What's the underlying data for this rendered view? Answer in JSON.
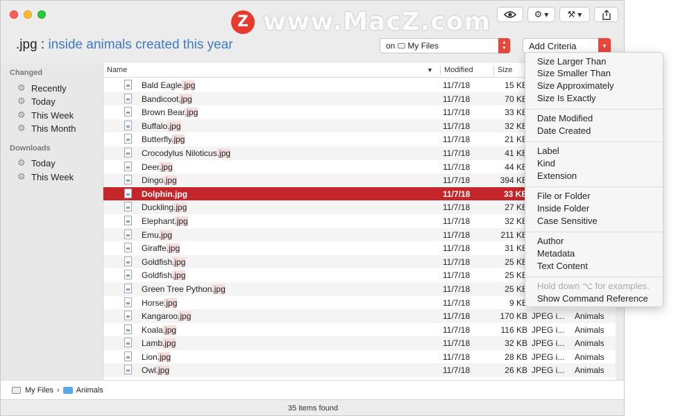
{
  "watermark": {
    "logo_letter": "Z",
    "text": "www.MacZ.com"
  },
  "toolbar": {
    "eye_icon": "eye-icon",
    "gear_icon": "gear-icon",
    "tools_icon": "tools-icon",
    "share_icon": "share-icon"
  },
  "query": {
    "extension": ".jpg",
    "colon": ":",
    "description": "inside animals created this year"
  },
  "location": {
    "prefix": "on",
    "value": "My Files"
  },
  "criteria_button": {
    "label": "Add Criteria"
  },
  "sidebar": {
    "sections": [
      {
        "heading": "Changed",
        "items": [
          "Recently",
          "Today",
          "This Week",
          "This Month"
        ]
      },
      {
        "heading": "Downloads",
        "items": [
          "Today",
          "This Week"
        ]
      }
    ]
  },
  "table": {
    "columns": {
      "name": "Name",
      "modified": "Modified",
      "size": "Size"
    },
    "rows": [
      {
        "base": "Bald Eagle",
        "ext": ".jpg",
        "modified": "11/7/18",
        "size": "15 KB",
        "kind": "",
        "folder": ""
      },
      {
        "base": "Bandicoot",
        "ext": ".jpg",
        "modified": "11/7/18",
        "size": "70 KB",
        "kind": "",
        "folder": ""
      },
      {
        "base": "Brown Bear",
        "ext": ".jpg",
        "modified": "11/7/18",
        "size": "33 KB",
        "kind": "",
        "folder": ""
      },
      {
        "base": "Buffalo",
        "ext": ".jpg",
        "modified": "11/7/18",
        "size": "32 KB",
        "kind": "",
        "folder": ""
      },
      {
        "base": "Butterfly",
        "ext": ".jpg",
        "modified": "11/7/18",
        "size": "21 KB",
        "kind": "",
        "folder": ""
      },
      {
        "base": "Crocodylus Niloticus",
        "ext": ".jpg",
        "modified": "11/7/18",
        "size": "41 KB",
        "kind": "",
        "folder": ""
      },
      {
        "base": "Deer",
        "ext": ".jpg",
        "modified": "11/7/18",
        "size": "44 KB",
        "kind": "",
        "folder": ""
      },
      {
        "base": "Dingo",
        "ext": ".jpg",
        "modified": "11/7/18",
        "size": "394 KB",
        "kind": "",
        "folder": ""
      },
      {
        "base": "Dolphin",
        "ext": ".jpg",
        "modified": "11/7/18",
        "size": "33 KB",
        "kind": "",
        "folder": "",
        "selected": true
      },
      {
        "base": "Duckling",
        "ext": ".jpg",
        "modified": "11/7/18",
        "size": "27 KB",
        "kind": "",
        "folder": ""
      },
      {
        "base": "Elephant",
        "ext": ".jpg",
        "modified": "11/7/18",
        "size": "32 KB",
        "kind": "",
        "folder": ""
      },
      {
        "base": "Emu",
        "ext": ".jpg",
        "modified": "11/7/18",
        "size": "211 KB",
        "kind": "",
        "folder": ""
      },
      {
        "base": "Giraffe",
        "ext": ".jpg",
        "modified": "11/7/18",
        "size": "31 KB",
        "kind": "",
        "folder": ""
      },
      {
        "base": "Goldfish",
        "ext": ".jpg",
        "modified": "11/7/18",
        "size": "25 KB",
        "kind": "",
        "folder": ""
      },
      {
        "base": "Goldfish",
        "ext": ".jpg",
        "modified": "11/7/18",
        "size": "25 KB",
        "kind": "",
        "folder": ""
      },
      {
        "base": "Green Tree Python",
        "ext": ".jpg",
        "modified": "11/7/18",
        "size": "25 KB",
        "kind": "",
        "folder": ""
      },
      {
        "base": "Horse",
        "ext": ".jpg",
        "modified": "11/7/18",
        "size": "9 KB",
        "kind": "",
        "folder": ""
      },
      {
        "base": "Kangaroo",
        "ext": ".jpg",
        "modified": "11/7/18",
        "size": "170 KB",
        "kind": "JPEG i...",
        "folder": "Animals"
      },
      {
        "base": "Koala",
        "ext": ".jpg",
        "modified": "11/7/18",
        "size": "116 KB",
        "kind": "JPEG i...",
        "folder": "Animals"
      },
      {
        "base": "Lamb",
        "ext": ".jpg",
        "modified": "11/7/18",
        "size": "32 KB",
        "kind": "JPEG i...",
        "folder": "Animals"
      },
      {
        "base": "Lion",
        "ext": ".jpg",
        "modified": "11/7/18",
        "size": "28 KB",
        "kind": "JPEG i...",
        "folder": "Animals"
      },
      {
        "base": "Owl",
        "ext": ".jpg",
        "modified": "11/7/18",
        "size": "26 KB",
        "kind": "JPEG i...",
        "folder": "Animals"
      }
    ]
  },
  "pathbar": {
    "root": "My Files",
    "separator": "›",
    "folder": "Animals"
  },
  "status": {
    "text": "35 items found"
  },
  "menu": {
    "groups": [
      [
        "Size Larger Than",
        "Size Smaller Than",
        "Size Approximately",
        "Size Is Exactly"
      ],
      [
        "Date Modified",
        "Date Created"
      ],
      [
        "Label",
        "Kind",
        "Extension"
      ],
      [
        "File or Folder",
        "Inside Folder",
        "Case Sensitive"
      ],
      [
        "Author",
        "Metadata",
        "Text Content"
      ]
    ],
    "hint": "Hold down ⌥ for examples.",
    "last": "Show Command Reference"
  },
  "colors": {
    "accent_red": "#c5262c",
    "link_blue": "#3e78c6",
    "stepper_red": "#e7473b"
  }
}
